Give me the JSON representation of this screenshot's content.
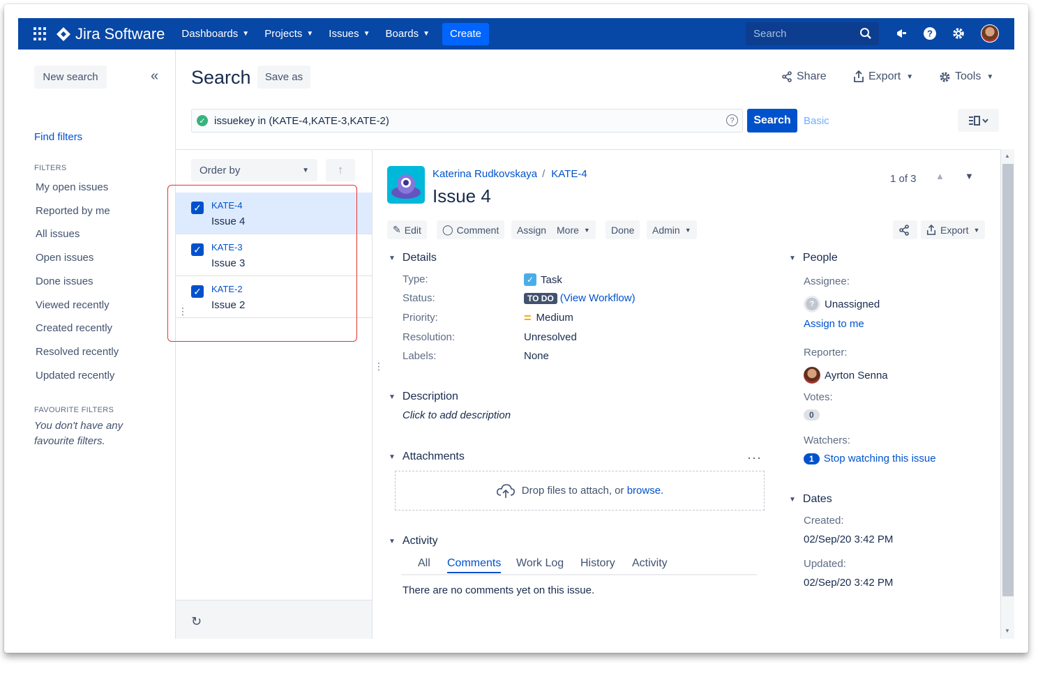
{
  "nav": {
    "product_name": "Jira Software",
    "menu": [
      {
        "label": "Dashboards"
      },
      {
        "label": "Projects"
      },
      {
        "label": "Issues"
      },
      {
        "label": "Boards"
      }
    ],
    "create_label": "Create",
    "search_placeholder": "Search"
  },
  "sidebar": {
    "new_search": "New search",
    "find_filters": "Find filters",
    "filters_heading": "FILTERS",
    "filters": [
      "My open issues",
      "Reported by me",
      "All issues",
      "Open issues",
      "Done issues",
      "Viewed recently",
      "Created recently",
      "Resolved recently",
      "Updated recently"
    ],
    "favourites_heading": "FAVOURITE FILTERS",
    "favourites_empty": "You don't have any favourite filters."
  },
  "header": {
    "title": "Search",
    "save_as": "Save as",
    "share": "Share",
    "export": "Export",
    "tools": "Tools"
  },
  "query": {
    "jql": "issuekey in (KATE-4,KATE-3,KATE-2)",
    "search_button": "Search",
    "basic_link": "Basic"
  },
  "list": {
    "order_by": "Order by",
    "issues": [
      {
        "key": "KATE-4",
        "summary": "Issue 4",
        "checked": true,
        "selected": true
      },
      {
        "key": "KATE-3",
        "summary": "Issue 3",
        "checked": true,
        "selected": false
      },
      {
        "key": "KATE-2",
        "summary": "Issue 2",
        "checked": true,
        "selected": false
      }
    ]
  },
  "issue": {
    "project": "Katerina Rudkovskaya",
    "key": "KATE-4",
    "title": "Issue 4",
    "pager": "1 of 3",
    "toolbar": {
      "edit": "Edit",
      "comment": "Comment",
      "assign": "Assign",
      "more": "More",
      "done": "Done",
      "admin": "Admin",
      "export": "Export"
    },
    "details_heading": "Details",
    "details": {
      "type_label": "Type:",
      "type_value": "Task",
      "status_label": "Status:",
      "status_value": "TO DO",
      "status_link": "(View Workflow)",
      "priority_label": "Priority:",
      "priority_value": "Medium",
      "resolution_label": "Resolution:",
      "resolution_value": "Unresolved",
      "labels_label": "Labels:",
      "labels_value": "None"
    },
    "description_heading": "Description",
    "description_placeholder": "Click to add description",
    "attachments_heading": "Attachments",
    "drop_text": "Drop files to attach, or",
    "browse_link": "browse.",
    "activity_heading": "Activity",
    "activity_tabs": [
      "All",
      "Comments",
      "Work Log",
      "History",
      "Activity"
    ],
    "active_tab": "Comments",
    "no_comments": "There are no comments yet on this issue.",
    "people_heading": "People",
    "assignee_label": "Assignee:",
    "assignee_value": "Unassigned",
    "assign_to_me": "Assign to me",
    "reporter_label": "Reporter:",
    "reporter_value": "Ayrton Senna",
    "votes_label": "Votes:",
    "votes_value": "0",
    "watchers_label": "Watchers:",
    "watchers_count": "1",
    "watchers_link": "Stop watching this issue",
    "dates_heading": "Dates",
    "created_label": "Created:",
    "created_value": "02/Sep/20 3:42 PM",
    "updated_label": "Updated:",
    "updated_value": "02/Sep/20 3:42 PM"
  },
  "colors": {
    "nav_bg": "#0747a6",
    "primary": "#0052cc",
    "selected_row": "#deebff",
    "highlight_box": "#e5322d"
  }
}
